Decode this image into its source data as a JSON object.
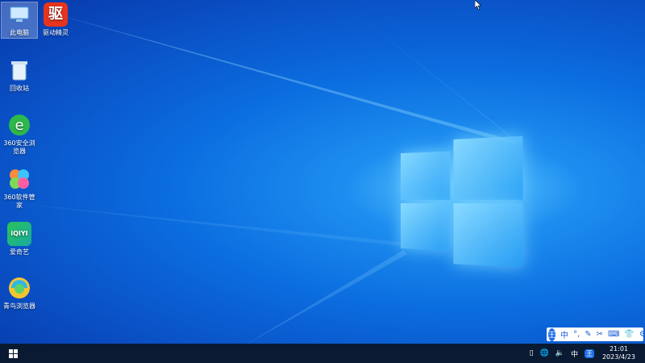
{
  "desktop": {
    "icons": [
      {
        "label": "此电脑"
      },
      {
        "label": "驱动精灵",
        "glyph_text": "驱"
      },
      {
        "label": "回收站"
      },
      {
        "label": "360安全浏览器"
      },
      {
        "label": "360软件管家"
      },
      {
        "label": "爱奇艺",
        "glyph_text": "iQIYI"
      },
      {
        "label": "青鸟浏览器"
      }
    ]
  },
  "ime_toolbar": {
    "badge": "王",
    "mode": "中",
    "items": [
      "punctuation-icon",
      "pen-icon",
      "scissors-icon",
      "keyboard-icon",
      "shirt-icon",
      "gear-icon"
    ]
  },
  "taskbar": {
    "tray": {
      "input_mode": "中",
      "ime_badge": "王"
    },
    "clock": {
      "time": "21:01",
      "date": "2023/4/23"
    }
  },
  "colors": {
    "accent": "#1d6fe8",
    "taskbar": "#0a1a33"
  }
}
